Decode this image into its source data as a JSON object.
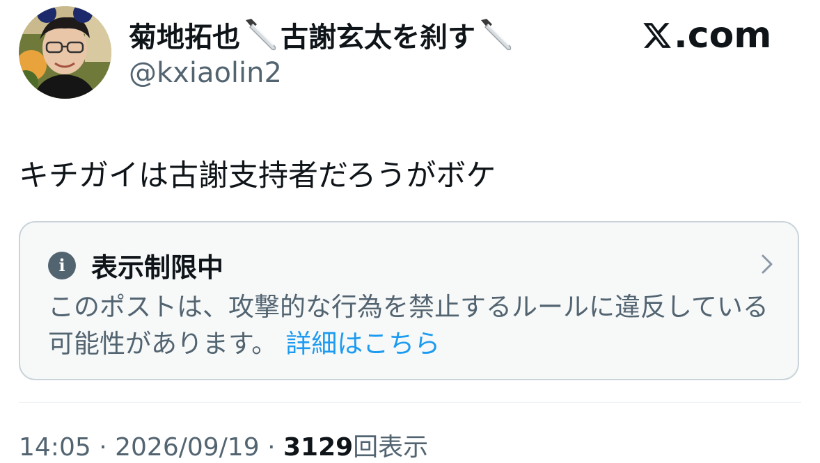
{
  "author": {
    "name_part1": "菊地拓也",
    "name_part2": "古謝玄太を刹す",
    "name_emoji": "kitchen-knife-icon",
    "handle": "@kxiaolin2"
  },
  "brand": {
    "logo": "x-logo-icon",
    "domain_suffix": ".com"
  },
  "post": {
    "text": "キチガイは古謝支持者だろうがボケ"
  },
  "notice": {
    "icon": "info-icon",
    "title": "表示制限中",
    "body": "このポストは、攻撃的な行為を禁止するルールに違反している可能性があります。",
    "link_label": "詳細はこちら"
  },
  "meta": {
    "time": "14:05",
    "separator": "·",
    "date": "2026/09/19",
    "views": "3129",
    "views_label": "回表示"
  },
  "colors": {
    "text_primary": "#0f1419",
    "text_secondary": "#536471",
    "link": "#1d9bf0",
    "notice_bg": "#f7f9f9",
    "notice_border": "#c9d4da"
  }
}
